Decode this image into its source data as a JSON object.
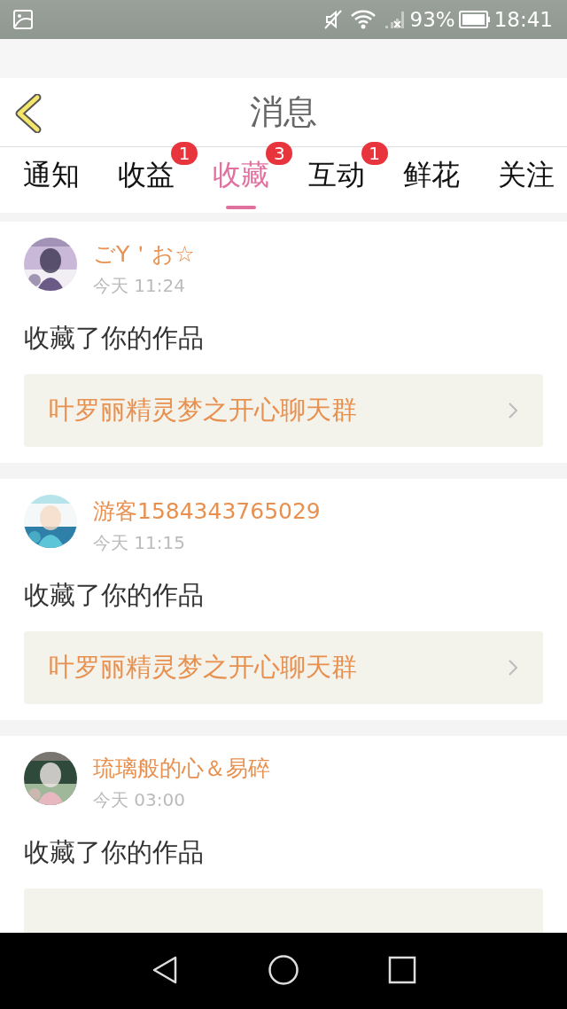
{
  "status_bar": {
    "battery_percent": "93%",
    "time": "18:41"
  },
  "header": {
    "title": "消息"
  },
  "tabs": [
    {
      "label": "通知",
      "selected": false
    },
    {
      "label": "收益",
      "selected": false,
      "badge": "1"
    },
    {
      "label": "收藏",
      "selected": true,
      "badge": "3"
    },
    {
      "label": "互动",
      "selected": false,
      "badge": "1"
    },
    {
      "label": "鲜花",
      "selected": false
    },
    {
      "label": "关注",
      "selected": false
    }
  ],
  "messages": [
    {
      "user": "ごY＇お☆",
      "time": "今天 11:24",
      "text": "收藏了你的作品",
      "link": "叶罗丽精灵梦之开心聊天群"
    },
    {
      "user": "游客1584343765029",
      "time": "今天 11:15",
      "text": "收藏了你的作品",
      "link": "叶罗丽精灵梦之开心聊天群"
    },
    {
      "user": "琉璃般的心＆易碎",
      "time": "今天 03:00",
      "text": "收藏了你的作品"
    }
  ]
}
